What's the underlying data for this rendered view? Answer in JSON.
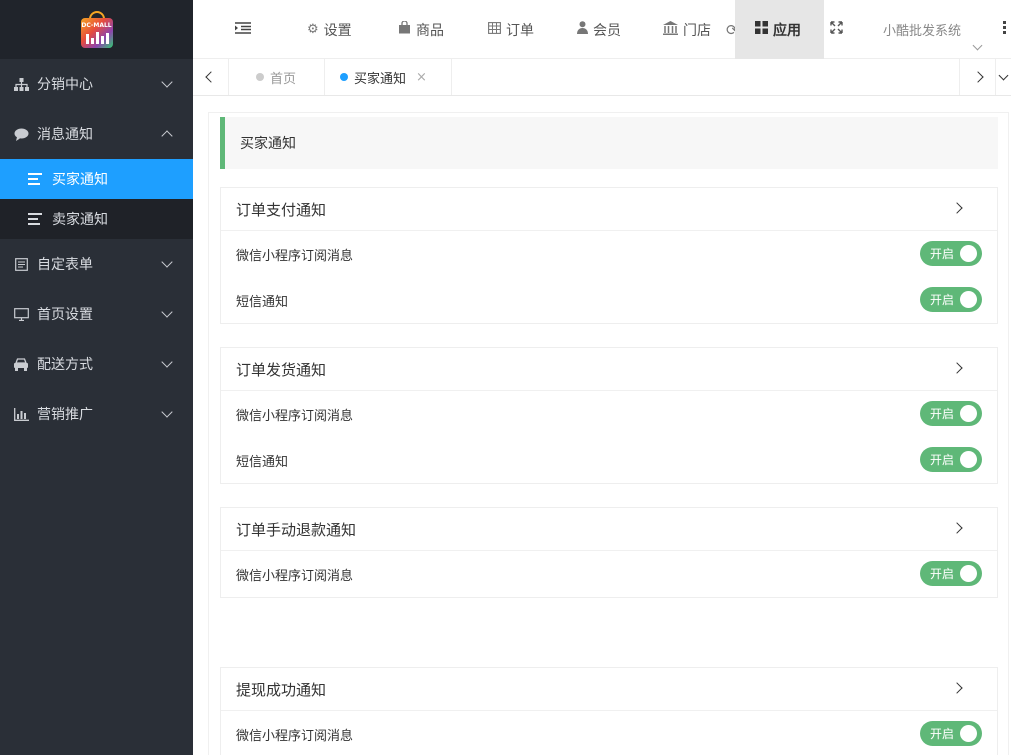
{
  "logo": {
    "text": "DC-MALL"
  },
  "sidebar": {
    "groups": [
      {
        "label": "分销中心",
        "icon": "sitemap-icon",
        "expanded": false
      },
      {
        "label": "消息通知",
        "icon": "comment-icon",
        "expanded": true,
        "children": [
          {
            "label": "买家通知",
            "active": true
          },
          {
            "label": "卖家通知",
            "active": false
          }
        ]
      },
      {
        "label": "自定表单",
        "icon": "form-icon",
        "expanded": false
      },
      {
        "label": "首页设置",
        "icon": "monitor-icon",
        "expanded": false
      },
      {
        "label": "配送方式",
        "icon": "car-icon",
        "expanded": false
      },
      {
        "label": "营销推广",
        "icon": "bar-chart-icon",
        "expanded": false
      }
    ]
  },
  "header": {
    "items": [
      {
        "label": "设置",
        "icon": "gears-icon"
      },
      {
        "label": "商品",
        "icon": "shopping-bag-icon"
      },
      {
        "label": "订单",
        "icon": "table-icon"
      },
      {
        "label": "会员",
        "icon": "user-icon"
      },
      {
        "label": "门店",
        "icon": "bank-icon"
      },
      {
        "label": "应用",
        "icon": "grid-icon",
        "active": true
      }
    ],
    "system_name": "小酷批发系统"
  },
  "tabs": [
    {
      "label": "首页",
      "active": false
    },
    {
      "label": "买家通知",
      "active": true,
      "close": "×"
    }
  ],
  "page": {
    "title": "买家通知",
    "cards": [
      {
        "title": "订单支付通知",
        "rows": [
          {
            "label": "微信小程序订阅消息",
            "switch": "开启"
          },
          {
            "label": "短信通知",
            "switch": "开启"
          }
        ]
      },
      {
        "title": "订单发货通知",
        "rows": [
          {
            "label": "微信小程序订阅消息",
            "switch": "开启"
          },
          {
            "label": "短信通知",
            "switch": "开启"
          }
        ]
      },
      {
        "title": "订单手动退款通知",
        "rows": [
          {
            "label": "微信小程序订阅消息",
            "switch": "开启"
          }
        ]
      },
      {
        "title": "提现成功通知",
        "rows": [
          {
            "label": "微信小程序订阅消息",
            "switch": "开启"
          }
        ]
      }
    ]
  },
  "colors": {
    "sidebar_bg": "#2a2f37",
    "accent": "#1e9fff",
    "switch_on": "#5fb878"
  }
}
